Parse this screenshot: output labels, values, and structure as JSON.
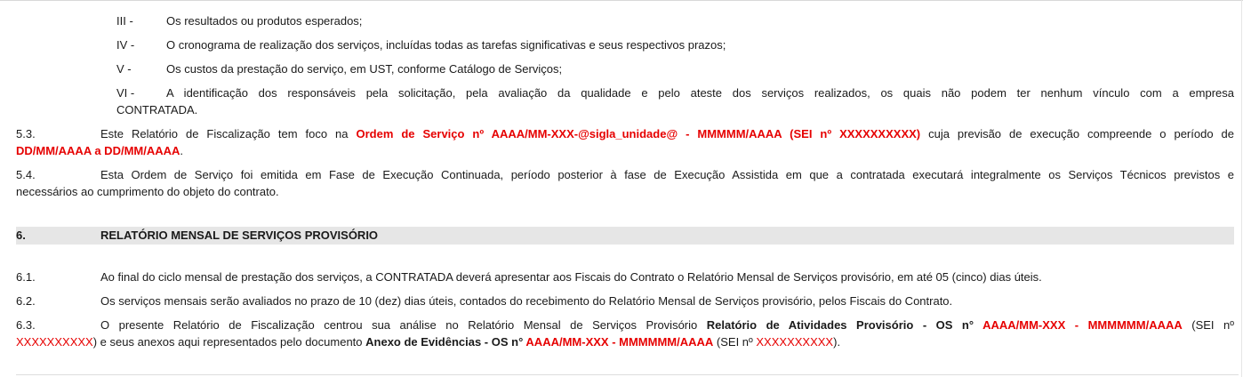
{
  "list": [
    {
      "roman": "III -",
      "text": "Os resultados ou produtos esperados;"
    },
    {
      "roman": "IV -",
      "text": "O cronograma de realização dos serviços, incluídas todas as tarefas significativas e seus respectivos prazos;"
    },
    {
      "roman": "V -",
      "text": "Os custos da prestação do serviço, em UST, conforme Catálogo de Serviços;"
    },
    {
      "roman": "VI -",
      "text_line1": "A identificação dos responsáveis pela solicitação, pela avaliação da qualidade e pelo ateste dos serviços realizados, os quais não podem ter nenhum vínculo com a empresa",
      "text_line2": "CONTRATADA."
    }
  ],
  "p53": {
    "num": "5.3.",
    "pre": "Este Relatório de Fiscalização tem foco na ",
    "highlight": "Ordem de Serviço nº AAAA/MM-XXX-@sigla_unidade@ - MMMMM/AAAA (SEI nº XXXXXXXXXX)",
    "post": " cuja previsão de execução compreende o período de",
    "line2_highlight": "DD/MM/AAAA a DD/MM/AAAA",
    "line2_end": "."
  },
  "p54": {
    "num": "5.4.",
    "line1": "Esta Ordem de Serviço foi emitida em Fase de Execução Continuada, período posterior à fase de Execução Assistida em que a contratada executará integralmente os Serviços Técnicos previstos e",
    "line2": "necessários ao cumprimento do objeto do contrato."
  },
  "section": {
    "num": "6.",
    "title": "RELATÓRIO MENSAL DE SERVIÇOS PROVISÓRIO"
  },
  "p61": {
    "num": "6.1.",
    "text": "Ao final do ciclo mensal de prestação dos serviços, a CONTRATADA deverá apresentar aos Fiscais do Contrato o Relatório Mensal de Serviços provisório, em até 05 (cinco) dias úteis."
  },
  "p62": {
    "num": "6.2.",
    "text": "Os serviços mensais serão avaliados no prazo de 10 (dez) dias úteis, contados do recebimento do Relatório Mensal de Serviços provisório, pelos Fiscais do Contrato."
  },
  "p63": {
    "num": "6.3.",
    "pre": "O presente Relatório de Fiscalização centrou sua análise no Relatório Mensal de Serviços Provisório ",
    "bold1": "Relatório de Atividades Provisório - OS n° ",
    "red1": "AAAA/MM-XXX - MMMMMM/AAAA",
    "mid1": " (SEI nº",
    "l2_red1": "XXXXXXXXXX",
    "l2_mid": ") e seus anexos aqui representados pelo documento ",
    "l2_bold": "Anexo de Evidências - OS n° ",
    "l2_red2": "AAAA/MM-XXX - MMMMMM/AAAA",
    "l2_mid2": " (SEI nº ",
    "l2_red3": "XXXXXXXXXX",
    "l2_end": ")."
  },
  "colors": {
    "highlight": "#e60000",
    "section_bg": "#e6e6e6"
  }
}
